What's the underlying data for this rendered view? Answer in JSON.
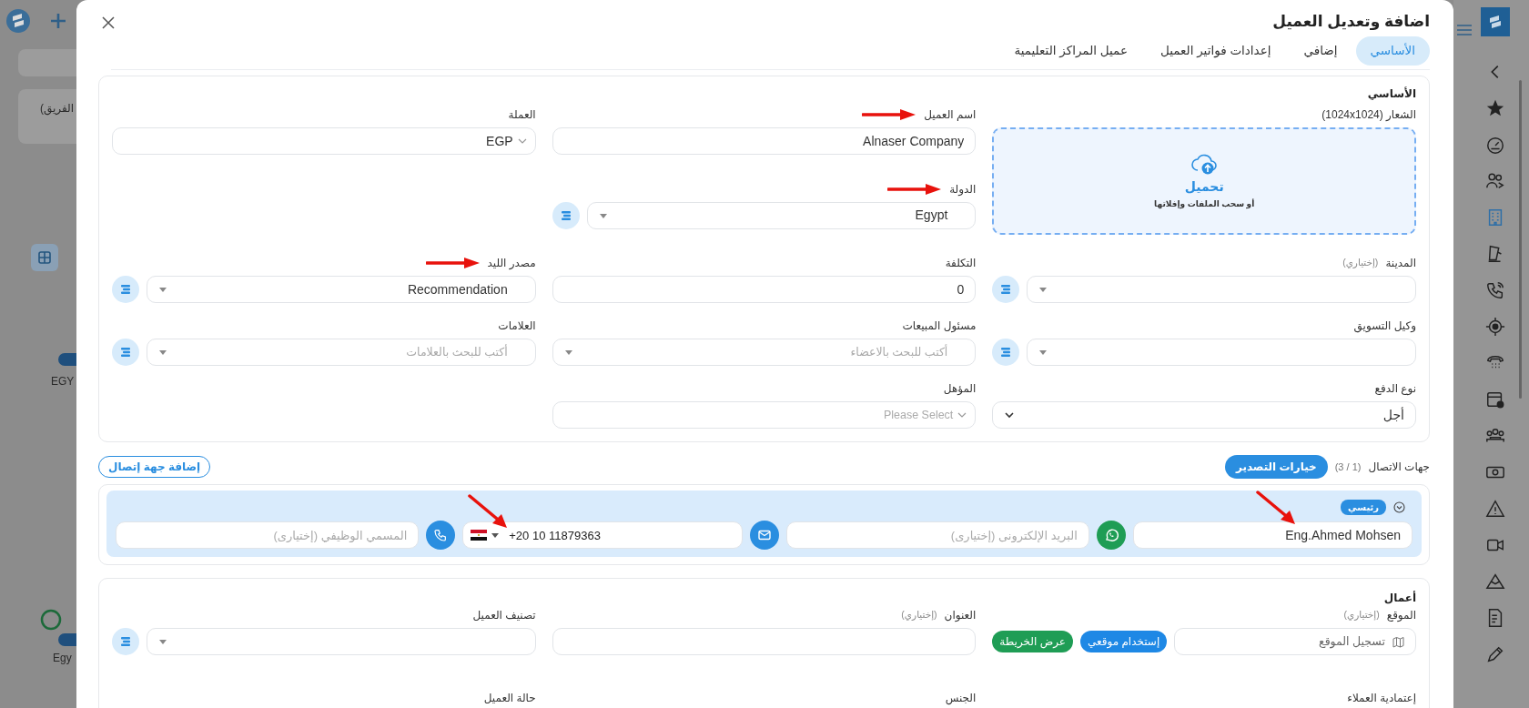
{
  "window": {
    "title": "اضافة وتعديل العميل"
  },
  "background": {
    "texts": [
      "(الفريق",
      "EGY",
      "Egy"
    ]
  },
  "tabs": [
    {
      "label": "الأساسي",
      "selected": true
    },
    {
      "label": "إضافي",
      "selected": false
    },
    {
      "label": "إعدادات فواتير العميل",
      "selected": false
    },
    {
      "label": "عميل المراكز التعليمية",
      "selected": false
    }
  ],
  "basic": {
    "title": "الأساسي",
    "upload": {
      "label": "الشعار (1024x1024)",
      "action": "تحميل",
      "note": "أو سحب الملفات وإفلاتها"
    },
    "fields": [
      {
        "label": "اسم العميل",
        "kind": "text",
        "value": "Alnaser Company",
        "annotated": true
      },
      {
        "label": "العملة",
        "kind": "picker",
        "value": "EGP",
        "annotated": false
      },
      {
        "label": "الدولة",
        "kind": "select",
        "value": "Egypt",
        "action": true,
        "annotated": true
      },
      {
        "label": "المدينة",
        "hint": "(إختياري)",
        "kind": "select",
        "action": true,
        "annotated": false
      },
      {
        "label": "التكلفة",
        "kind": "text",
        "value": "0",
        "annotated": false
      },
      {
        "label": "مصدر الليد",
        "kind": "select",
        "value": "Recommendation",
        "action": true,
        "annotated": true
      },
      {
        "label": "وكيل التسويق",
        "kind": "select",
        "action": true,
        "annotated": false
      },
      {
        "label": "مسئول المبيعات",
        "kind": "select",
        "placeholder": "أكتب للبحث بالاعضاء",
        "action": false,
        "annotated": false
      },
      {
        "label": "العلامات",
        "kind": "select",
        "placeholder": "أكتب للبحث بالعلامات",
        "action": true,
        "annotated": false
      },
      {
        "label": "نوع الدفع",
        "kind": "dropdown",
        "value": "أجل",
        "annotated": false
      },
      {
        "label": "المؤهل",
        "kind": "picker",
        "placeholder": "Please Select",
        "annotated": false
      }
    ]
  },
  "contacts": {
    "title": "جهات الاتصال",
    "count": "(1 / 3)",
    "export_button": "خيارات التصدير",
    "add_button": "إضافة جهة إتصال",
    "items": [
      {
        "badge": "رئيسي",
        "name": "Eng.Ahmed Mohsen",
        "name_annotated": true,
        "email_placeholder": "البريد الإلكترونى (إختيارى)",
        "phone": "+20 10 11879363",
        "phone_annotated": true,
        "job_placeholder": "المسمي الوظيفي (إختيارى)"
      }
    ]
  },
  "work": {
    "title": "أعمال",
    "fields": [
      {
        "label": "الموقع",
        "hint": "(إختياري)",
        "kind": "location",
        "placeholder": "تسجيل الموقع",
        "annotated": false,
        "buttons": [
          {
            "label": "إستخدام موقعي",
            "color": "#1e88e5"
          },
          {
            "label": "عرض الخريطة",
            "color": "#1f9d55"
          }
        ]
      },
      {
        "label": "العنوان",
        "hint": "(إختياري)",
        "kind": "text",
        "annotated": false
      },
      {
        "label": "تصنيف العميل",
        "kind": "select",
        "action": true,
        "annotated": false
      }
    ],
    "next_labels": [
      "إعتمادية العملاء",
      "الجنس",
      "حالة العميل"
    ]
  },
  "sidebar": {
    "items": [
      {
        "selected": false
      },
      {
        "selected": false
      },
      {
        "selected": false
      },
      {
        "selected": true
      },
      {
        "selected": false
      },
      {
        "selected": false
      },
      {
        "selected": false
      },
      {
        "selected": false
      },
      {
        "selected": false
      },
      {
        "selected": false
      },
      {
        "selected": false
      },
      {
        "selected": false
      },
      {
        "selected": false
      },
      {
        "selected": false
      },
      {
        "selected": false
      },
      {
        "selected": false
      }
    ]
  }
}
